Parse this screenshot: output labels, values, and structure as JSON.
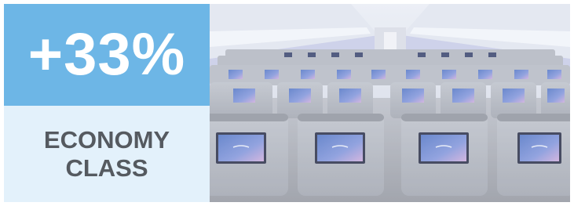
{
  "stat": {
    "value": "+33%",
    "label_line1": "ECONOMY",
    "label_line2": "CLASS"
  },
  "photo": {
    "subject": "economy-cabin-photo"
  },
  "colors": {
    "accent": "#6db6e6",
    "panel_light": "#e3f1fb",
    "label_text": "#555a60"
  }
}
